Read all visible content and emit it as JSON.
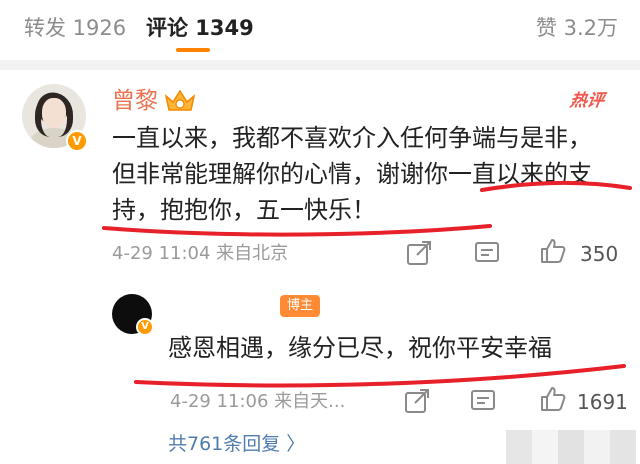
{
  "tabs": {
    "repost": "转发 1926",
    "comment": "评论 1349",
    "like": "赞 3.2万"
  },
  "comment": {
    "username": "曾黎",
    "hot_tag": "热评",
    "text": "一直以来，我都不喜欢介入任何争端与是非，但非常能理解你的心情，谢谢你一直以来的支持，抱抱你，五一快乐！",
    "time_source": "4-29 11:04 来自北京",
    "like_count": "350"
  },
  "reply": {
    "author_tag": "博主",
    "text": "感恩相遇，缘分已尽，祝你平安幸福",
    "time_source": "4-29 11:06 来自天...",
    "like_count": "1691"
  },
  "replies_link": "共761条回复 〉",
  "colors": {
    "accent": "#ff8200",
    "username": "#eb7350",
    "link": "#507daf",
    "annotation_red": "#e8202a"
  }
}
